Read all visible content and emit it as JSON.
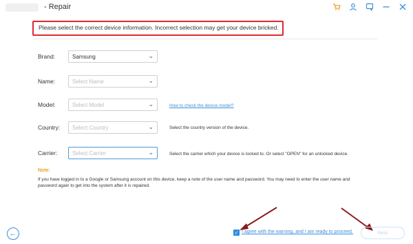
{
  "window": {
    "title": "- Repair"
  },
  "titlebar_icons": [
    "cart-icon",
    "account-icon",
    "feedback-icon",
    "minimize-icon",
    "close-icon"
  ],
  "warning": {
    "text": "Please select the correct device information. Incorrect selection may get your device bricked.",
    "highlight_color": "#e0272f"
  },
  "form": {
    "brand": {
      "label": "Brand:",
      "value": "Samsung"
    },
    "name": {
      "label": "Name:",
      "placeholder": "Select Name"
    },
    "model": {
      "label": "Model:",
      "placeholder": "Select Model",
      "help_link": "How to check the device model?"
    },
    "country": {
      "label": "Country:",
      "placeholder": "Select Country",
      "hint": "Select the country version of the device."
    },
    "carrier": {
      "label": "Carrier:",
      "placeholder": "Select Carrier",
      "hint": "Select the carrier which your device is locked to. Or select \"OPEN\" for an unlocked device."
    }
  },
  "note": {
    "title": "Note:",
    "text": "If you have logged in to a Google or Samsung account on this device, keep a note of the user name and password. You may need to enter the user name and password again to get into the system after it is repaired."
  },
  "footer": {
    "agree_text": "I agree with the warning, and I am ready to proceed.",
    "agree_checked": true,
    "next_label": "Next"
  },
  "colors": {
    "accent": "#3a8fd8",
    "note": "#f29d2c",
    "annotation_arrow": "#8b1a1a"
  }
}
